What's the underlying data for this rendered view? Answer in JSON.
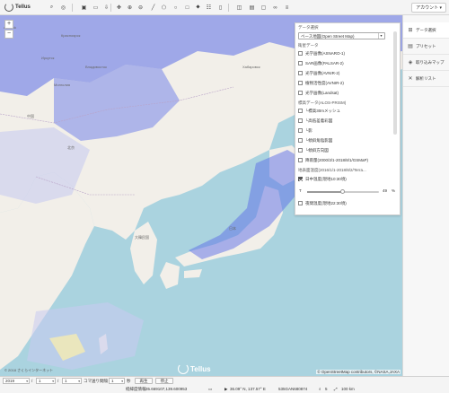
{
  "app": {
    "logo_text": "Tellus",
    "account_label": "アカウント"
  },
  "toolbar": {
    "icons": [
      "search-icon",
      "view-icon",
      "camera-icon",
      "folder-icon",
      "download-icon",
      "pan-icon",
      "zoom-in-icon",
      "zoom-out-icon",
      "line-icon",
      "polygon-icon",
      "circle-icon",
      "rectangle-icon",
      "pin-icon",
      "layers-icon",
      "trash-icon",
      "split-icon",
      "compare-icon",
      "window-icon",
      "link-icon",
      "settings-icon"
    ]
  },
  "map": {
    "labels": [
      {
        "text": "Achinsk",
        "name": "achinsk"
      },
      {
        "text": "Красноярск",
        "name": "krasnoyarsk"
      },
      {
        "text": "Иркутск",
        "name": "irkutsk"
      },
      {
        "text": "Монголия",
        "name": "mongolia"
      },
      {
        "text": "Хабаровск",
        "name": "khabarovsk"
      },
      {
        "text": "Владивосток",
        "name": "vladivostok"
      },
      {
        "text": "中国",
        "name": "china"
      },
      {
        "text": "北京",
        "name": "beijing"
      },
      {
        "text": "大韓民国",
        "name": "korea"
      },
      {
        "text": "日本",
        "name": "japan"
      }
    ],
    "attribution": "© OpenStreetMap contributors, ©NASA,JAXA",
    "copyright_left": "© 2018 さくらインターネット",
    "bottom_logo": "Tellus"
  },
  "panel": {
    "title": "データ選択",
    "base_map": "ベース地図(Open Street Map)",
    "section_satellite": "衛星データ",
    "satellite_items": [
      {
        "label": "光学画像(ASNARO-1)",
        "checked": false
      },
      {
        "label": "SAR画像(PALSAR-2)",
        "checked": false
      },
      {
        "label": "光学画像(AVNIR-2)",
        "checked": false
      },
      {
        "label": "植物活性度(AVNIR-2)",
        "checked": false
      },
      {
        "label": "光学画像(Landsat)",
        "checked": false
      }
    ],
    "section_elevation": "標高データ(ALOS-PRISM)",
    "elevation_items": [
      {
        "label": "└標高30mメッシュ",
        "checked": false
      },
      {
        "label": "└高低差着彩図",
        "checked": false
      },
      {
        "label": "└影",
        "checked": false
      },
      {
        "label": "└傾斜角陰影図",
        "checked": false
      },
      {
        "label": "└傾斜方向図",
        "checked": false
      }
    ],
    "rain_item": {
      "label": "降雨量(2000/3/1-2018/8/1/GSMaP)",
      "checked": false
    },
    "section_temp": "地表面温度(2016/1/1-2018/8/2/Terra...",
    "day_temp": {
      "label": "日中温度(現地10:30頃)",
      "checked": true
    },
    "opacity": {
      "icon": "T",
      "value": "49",
      "unit": "%",
      "fraction": 0.49
    },
    "night_temp": {
      "label": "夜間温度(現地22:30頃)",
      "checked": false
    }
  },
  "sidebar": {
    "items": [
      {
        "label": "データ選択",
        "icon": "data-icon"
      },
      {
        "label": "プリセット",
        "icon": "preset-icon"
      },
      {
        "label": "取り込みマップ",
        "icon": "import-map-icon"
      },
      {
        "label": "解析リスト",
        "icon": "analysis-icon"
      }
    ]
  },
  "bottom": {
    "year": "2019",
    "month": "1",
    "day": "1",
    "repeat_label": "コマ送り間隔",
    "interval": "1",
    "unit": "秒",
    "play": "再生",
    "stop": "停止",
    "coords_label": "経緯度情報",
    "coords_value": "35.669107,139.600953",
    "pos_value": "36.09° N, 137.57° E",
    "mesh_value": "535GAN680874",
    "zoom_value": "5",
    "scale_value": "100 km"
  },
  "colors": {
    "sea": "#aad3df",
    "land": "#f2efe9",
    "overlay": "#5b6ee8",
    "overlay_light": "#c8cbf0"
  }
}
